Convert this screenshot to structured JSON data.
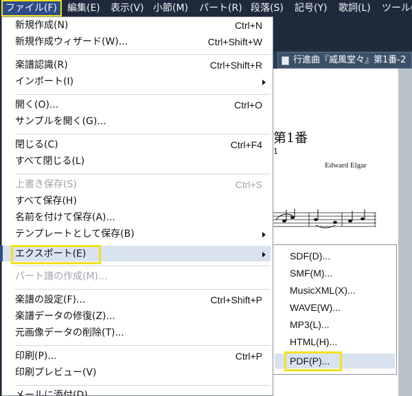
{
  "menubar": {
    "items": [
      "ファイル(F)",
      "編集(E)",
      "表示(V)",
      "小節(M)",
      "パート(R)",
      "段落(S)",
      "記号(Y)",
      "歌詞(L)",
      "ツール("
    ]
  },
  "document": {
    "tab_title": "行進曲『威風堂々』第1番-2",
    "score_title": "第1番",
    "score_sub": "1",
    "composer": "Edward Elgar"
  },
  "file_menu": {
    "new": {
      "label": "新規作成(N)",
      "shortcut": "Ctrl+N"
    },
    "new_wizard": {
      "label": "新規作成ウィザード(W)...",
      "shortcut": "Ctrl+Shift+W"
    },
    "recognize": {
      "label": "楽譜認識(R)",
      "shortcut": "Ctrl+Shift+R"
    },
    "import": {
      "label": "インポート(I)"
    },
    "open": {
      "label": "開く(O)...",
      "shortcut": "Ctrl+O"
    },
    "open_sample": {
      "label": "サンプルを開く(G)..."
    },
    "close": {
      "label": "閉じる(C)",
      "shortcut": "Ctrl+F4"
    },
    "close_all": {
      "label": "すべて閉じる(L)"
    },
    "save": {
      "label": "上書き保存(S)",
      "shortcut": "Ctrl+S"
    },
    "save_all": {
      "label": "すべて保存(H)"
    },
    "save_as": {
      "label": "名前を付けて保存(A)..."
    },
    "save_template": {
      "label": "テンプレートとして保存(B)"
    },
    "export": {
      "label": "エクスポート(E)"
    },
    "part_create": {
      "label": "パート譜の作成(M)..."
    },
    "score_settings": {
      "label": "楽譜の設定(F)...",
      "shortcut": "Ctrl+Shift+P"
    },
    "repair": {
      "label": "楽譜データの修復(Z)..."
    },
    "delete_image": {
      "label": "元画像データの削除(T)..."
    },
    "print": {
      "label": "印刷(P)...",
      "shortcut": "Ctrl+P"
    },
    "print_preview": {
      "label": "印刷プレビュー(V)"
    },
    "mail": {
      "label": "メールに添付(D)..."
    }
  },
  "export_submenu": {
    "items": [
      "SDF(D)...",
      "SMF(M)...",
      "MusicXML(X)...",
      "WAVE(W)...",
      "MP3(L)...",
      "HTML(H)...",
      "PDF(P)..."
    ]
  },
  "colors": {
    "highlight": "#f2e21b",
    "menubar_bg": "#1e2a3c",
    "selection": "#d9e3ef"
  }
}
